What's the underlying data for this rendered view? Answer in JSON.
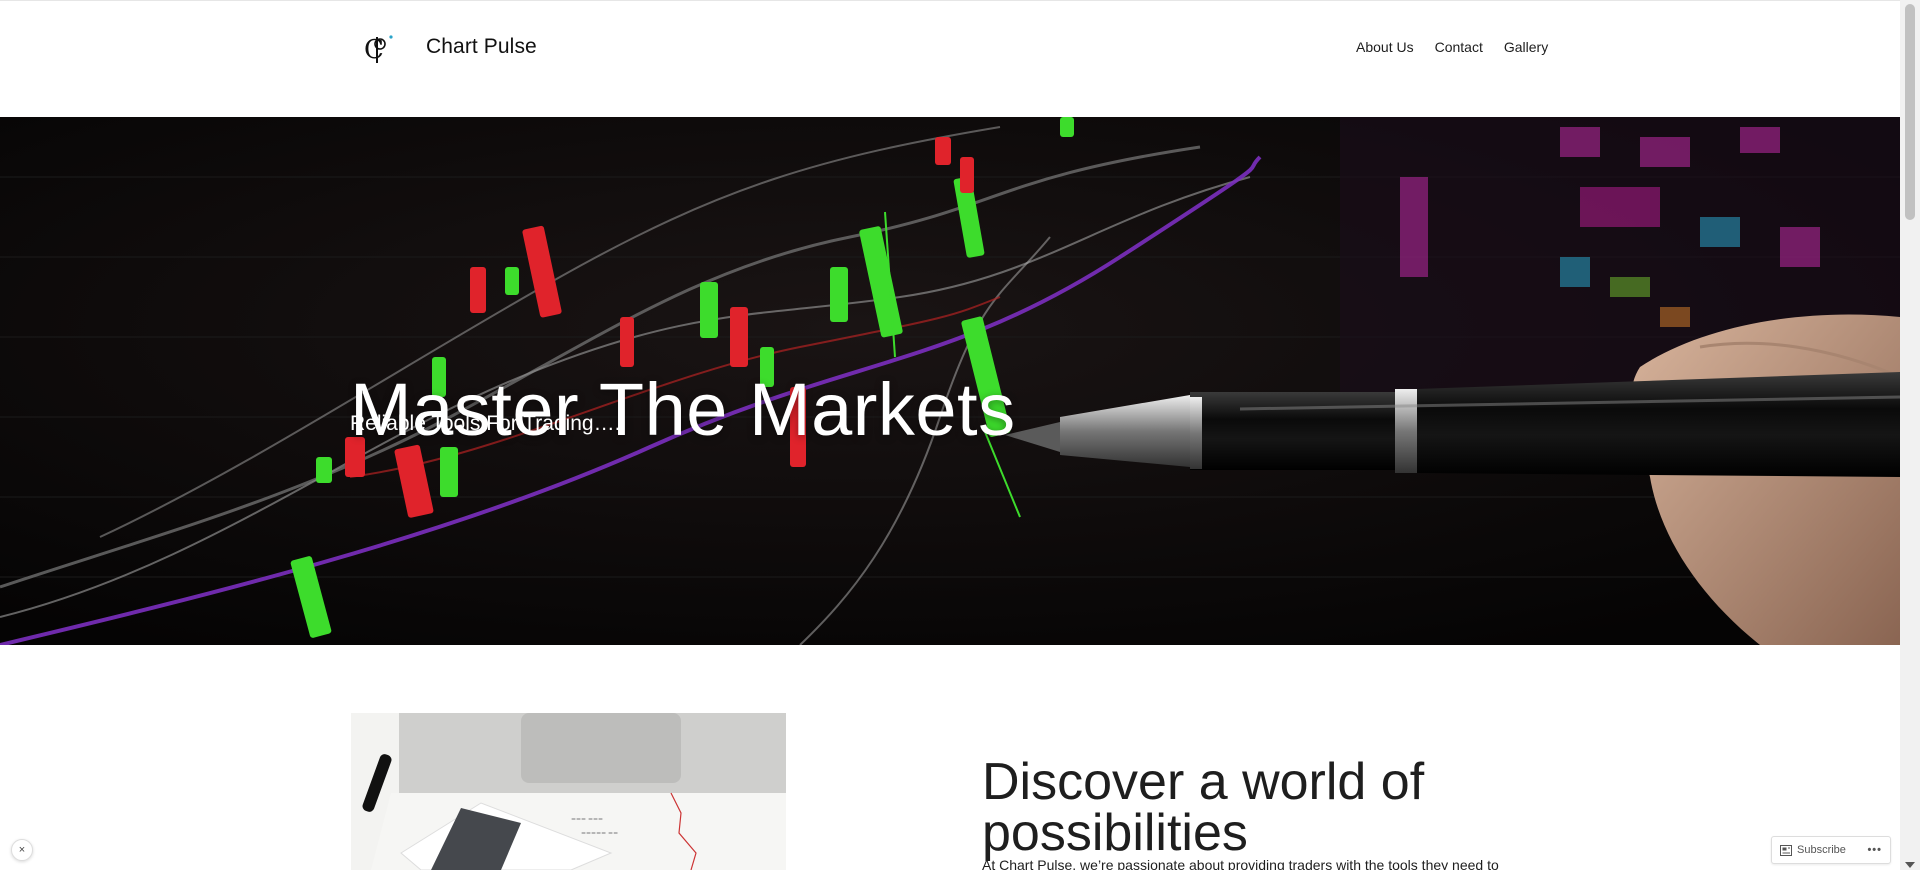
{
  "header": {
    "site_title": "Chart Pulse",
    "nav": [
      {
        "label": "About Us"
      },
      {
        "label": "Contact"
      },
      {
        "label": "Gallery"
      }
    ]
  },
  "hero": {
    "title": "Master The Markets",
    "subtitle": "Reliable Tools For Trading…."
  },
  "about": {
    "title": "Discover a world of possibilities",
    "text": "At Chart Pulse, we’re passionate about providing traders with the tools they need to succeed in the financial markets. We specialize in developing highly accurate trading"
  },
  "widgets": {
    "close_label": "×",
    "subscribe_label": "Subscribe",
    "more_label": "•••"
  },
  "colors": {
    "hero_bg": "#0b0a0a",
    "candle_green": "#3ddc2c",
    "candle_red": "#e0232b",
    "line_purple": "#8a2be2"
  }
}
